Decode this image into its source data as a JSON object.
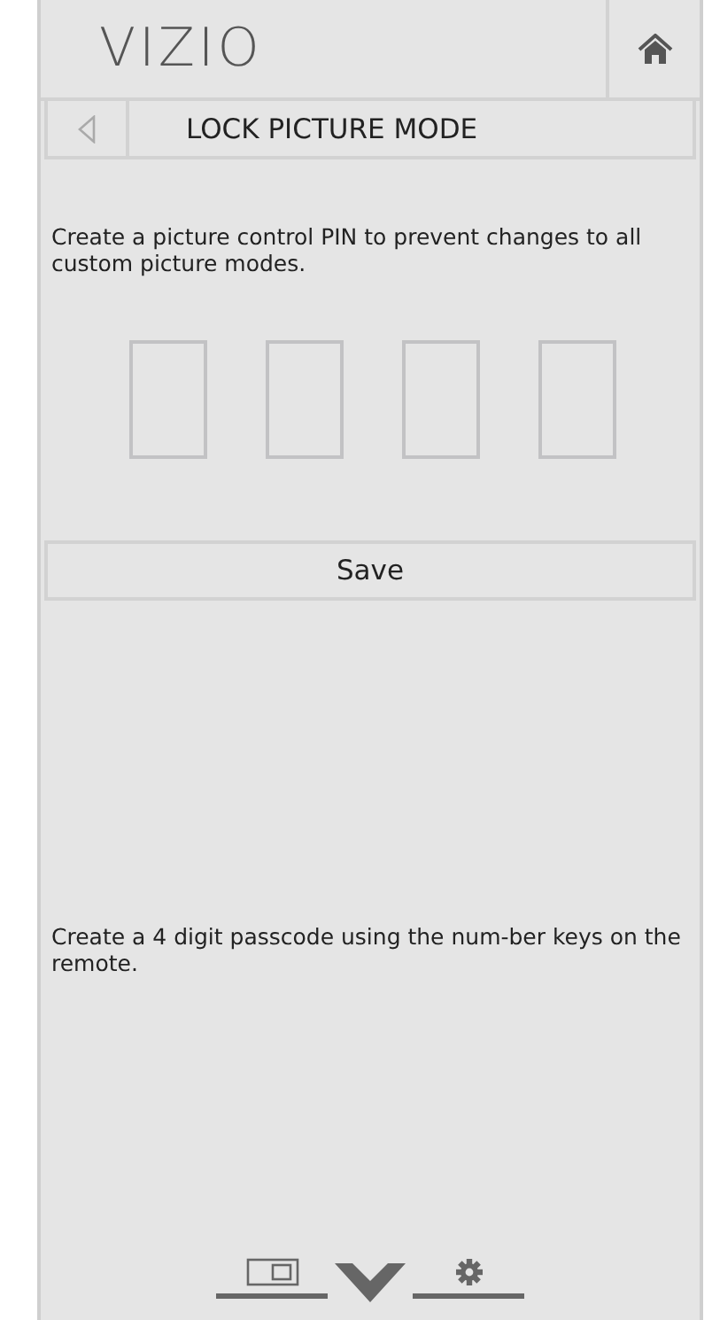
{
  "header": {
    "logo": "VIZIO"
  },
  "title_bar": {
    "title": "LOCK PICTURE MODE"
  },
  "description": "Create a picture control PIN to prevent changes to all custom picture modes.",
  "pin_boxes": [
    {
      "filled": false
    },
    {
      "filled": false
    },
    {
      "filled": false
    },
    {
      "filled": false
    }
  ],
  "save_button": "Save",
  "hint": "Create a 4 digit passcode using the num-ber keys on the remote."
}
